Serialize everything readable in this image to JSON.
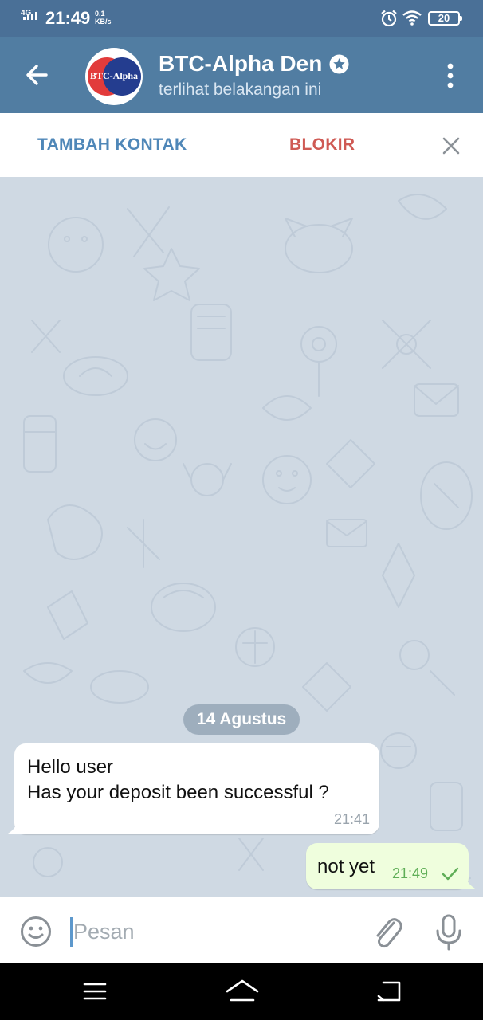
{
  "status_bar": {
    "network": "4G",
    "time": "21:49",
    "speed_value": "0.1",
    "speed_unit": "KB/s",
    "battery": "20",
    "icons": [
      "signal-icon",
      "alarm-icon",
      "wifi-icon",
      "battery-icon"
    ]
  },
  "header": {
    "avatar_text": "BTC-Alpha",
    "title": "BTC-Alpha Den",
    "subtitle": "terlihat belakangan ini",
    "icons": [
      "back-arrow-icon",
      "verified-star-icon",
      "more-vert-icon"
    ]
  },
  "action_bar": {
    "add_contact": "TAMBAH KONTAK",
    "block": "BLOKIR",
    "icons": [
      "close-icon"
    ]
  },
  "chat": {
    "date": "14 Agustus",
    "messages": [
      {
        "direction": "incoming",
        "lines": [
          "Hello user",
          "Has your deposit been successful ?"
        ],
        "time": "21:41"
      },
      {
        "direction": "outgoing",
        "text": "not yet",
        "time": "21:49",
        "status": "sent"
      }
    ]
  },
  "input_bar": {
    "placeholder": "Pesan",
    "value": "",
    "icons": [
      "emoji-icon",
      "paperclip-icon",
      "microphone-icon"
    ]
  },
  "nav_bar": {
    "icons": [
      "menu-icon",
      "home-icon",
      "back-icon"
    ]
  },
  "colors": {
    "status_bar": "#4a7097",
    "header": "#517da2",
    "add_contact": "#4f87b8",
    "block": "#cf5a54",
    "chat_background": "#cfd9e3",
    "outgoing_bubble": "#effedd",
    "outgoing_time": "#5fae57"
  }
}
